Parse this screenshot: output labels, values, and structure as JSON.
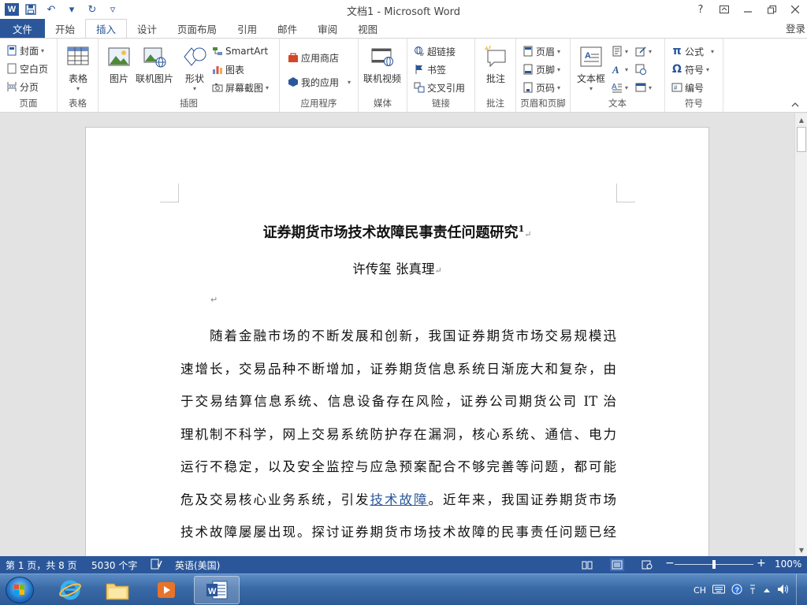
{
  "window": {
    "title": "文档1 - Microsoft Word",
    "help_glyph": "?",
    "login_label": "登录"
  },
  "tabs": {
    "file": "文件",
    "items": [
      "开始",
      "插入",
      "设计",
      "页面布局",
      "引用",
      "邮件",
      "审阅",
      "视图"
    ],
    "active": "插入"
  },
  "ribbon": {
    "pages": {
      "label": "页面",
      "cover": "封面",
      "blank": "空白页",
      "break": "分页"
    },
    "tables": {
      "label": "表格",
      "table": "表格"
    },
    "illustrations": {
      "label": "插图",
      "picture": "图片",
      "online_picture": "联机图片",
      "shapes": "形状",
      "smartart": "SmartArt",
      "chart": "图表",
      "screenshot": "屏幕截图"
    },
    "apps": {
      "label": "应用程序",
      "store": "应用商店",
      "my_apps": "我的应用"
    },
    "media": {
      "label": "媒体",
      "online_video": "联机视频"
    },
    "links": {
      "label": "链接",
      "hyperlink": "超链接",
      "bookmark": "书签",
      "cross_ref": "交叉引用"
    },
    "comments": {
      "label": "批注",
      "comment": "批注"
    },
    "header_footer": {
      "label": "页眉和页脚",
      "header": "页眉",
      "footer": "页脚",
      "page_number": "页码"
    },
    "text": {
      "label": "文本",
      "textbox": "文本框"
    },
    "symbols": {
      "label": "符号",
      "equation": "公式",
      "symbol": "符号",
      "numbering": "编号",
      "pi": "π",
      "omega": "Ω"
    }
  },
  "document": {
    "title": "证券期货市场技术故障民事责任问题研究",
    "footnote_ref": "1",
    "authors": "许传玺  张真理",
    "paragraph_mark": "↵",
    "lines": [
      "随着金融市场的不断发展和创新，我国证券期货市场交易规模迅",
      "速增长，交易品种不断增加，证券期货信息系统日渐庞大和复杂，由",
      "于交易结算信息系统、信息设备存在风险，证券公司期货公司 IT 治",
      "理机制不科学，网上交易系统防护存在漏洞，核心系统、通信、电力",
      "运行不稳定，以及安全监控与应急预案配合不够完善等问题，都可能"
    ],
    "line6_before": "危及交易核心业务系统，引发",
    "line6_link": "技术故障",
    "line6_after": "。近年来，我国证券期货市场",
    "line7": "技术故障屡屡出现。探讨证券期货市场技术故障的民事责任问题已经"
  },
  "statusbar": {
    "page_info": "第 1 页，共 8 页",
    "word_count": "5030 个字",
    "language": "英语(美国)",
    "zoom_minus": "−",
    "zoom_plus": "+",
    "zoom": "100%",
    "zoom_fraction": 0.5
  },
  "taskbar": {
    "ime": "CH",
    "accent": "#2b579a"
  }
}
